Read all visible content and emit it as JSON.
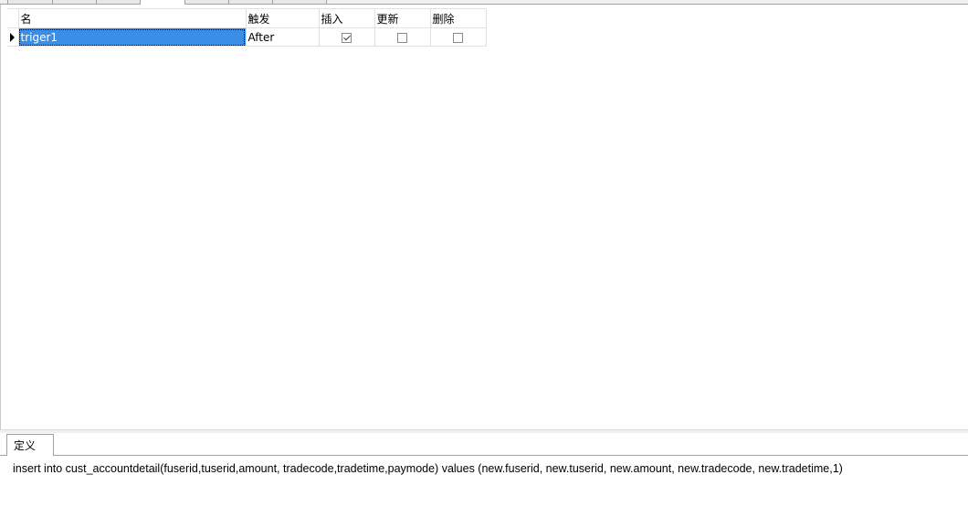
{
  "table": {
    "headers": {
      "name": "名",
      "trigger": "触发",
      "insert": "插入",
      "update": "更新",
      "delete": "删除"
    },
    "rows": [
      {
        "name": "triger1",
        "trigger": "After",
        "insert": true,
        "update": false,
        "delete": false
      }
    ]
  },
  "definition": {
    "tab_label": "定义",
    "sql": "insert into cust_accountdetail(fuserid,tuserid,amount, tradecode,tradetime,paymode) values (new.fuserid, new.tuserid, new.amount, new.tradecode, new.tradetime,1)"
  },
  "colors": {
    "selection": "#3a8ee6",
    "grid_line": "#e1e1e1"
  }
}
